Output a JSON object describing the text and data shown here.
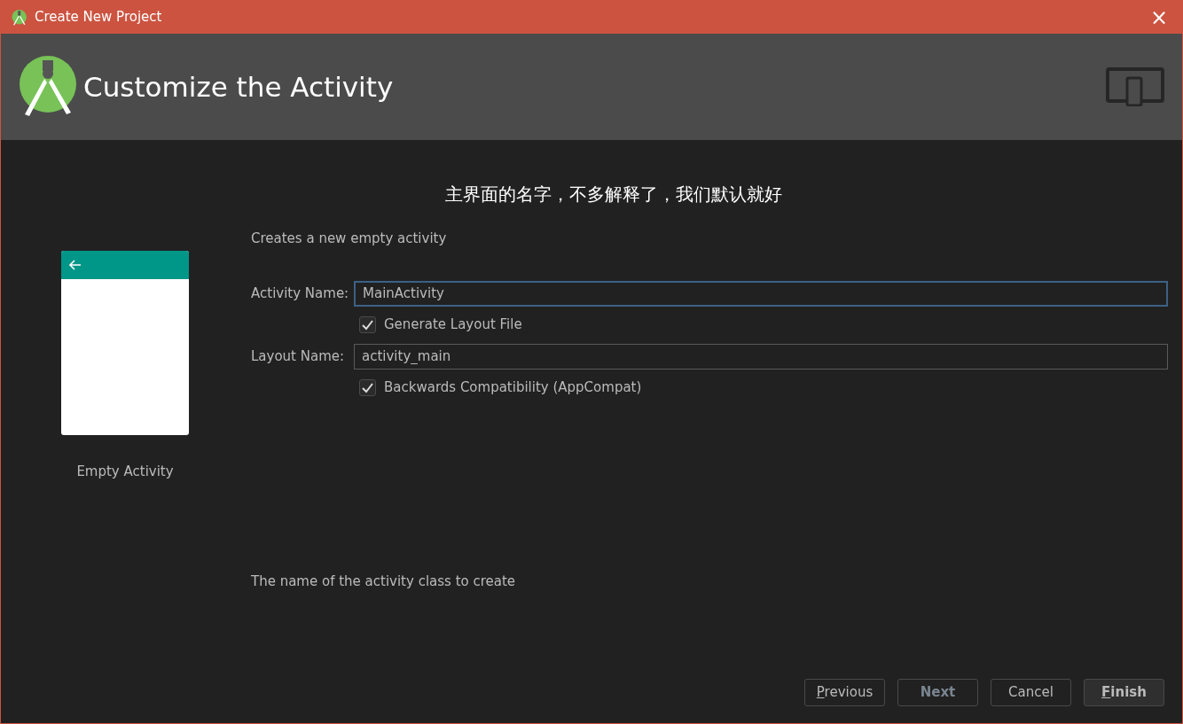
{
  "window": {
    "title": "Create New Project",
    "close": "×"
  },
  "header": {
    "title": "Customize the Activity"
  },
  "annotation": "主界面的名字，不多解释了，我们默认就好",
  "preview": {
    "label": "Empty Activity"
  },
  "description": "Creates a new empty activity",
  "form": [
    {
      "kind": "field",
      "label": "Activity Name:",
      "value": "MainActivity",
      "focused": true
    },
    {
      "kind": "checkbox",
      "label": "Generate Layout File",
      "checked": true
    },
    {
      "kind": "field",
      "label": "Layout Name:",
      "value": "activity_main",
      "focused": false
    },
    {
      "kind": "checkbox",
      "label": "Backwards Compatibility (AppCompat)",
      "checked": true
    }
  ],
  "hint": "The name of the activity class to create",
  "buttons": [
    {
      "mnemonic": "P",
      "rest": "revious",
      "disabled": false,
      "bold": false,
      "default": false
    },
    {
      "rest": "Next",
      "disabled": true,
      "bold": true,
      "default": false
    },
    {
      "rest": "Cancel",
      "disabled": false,
      "bold": false,
      "default": false
    },
    {
      "mnemonic": "F",
      "rest": "inish",
      "disabled": false,
      "bold": true,
      "default": true
    }
  ]
}
